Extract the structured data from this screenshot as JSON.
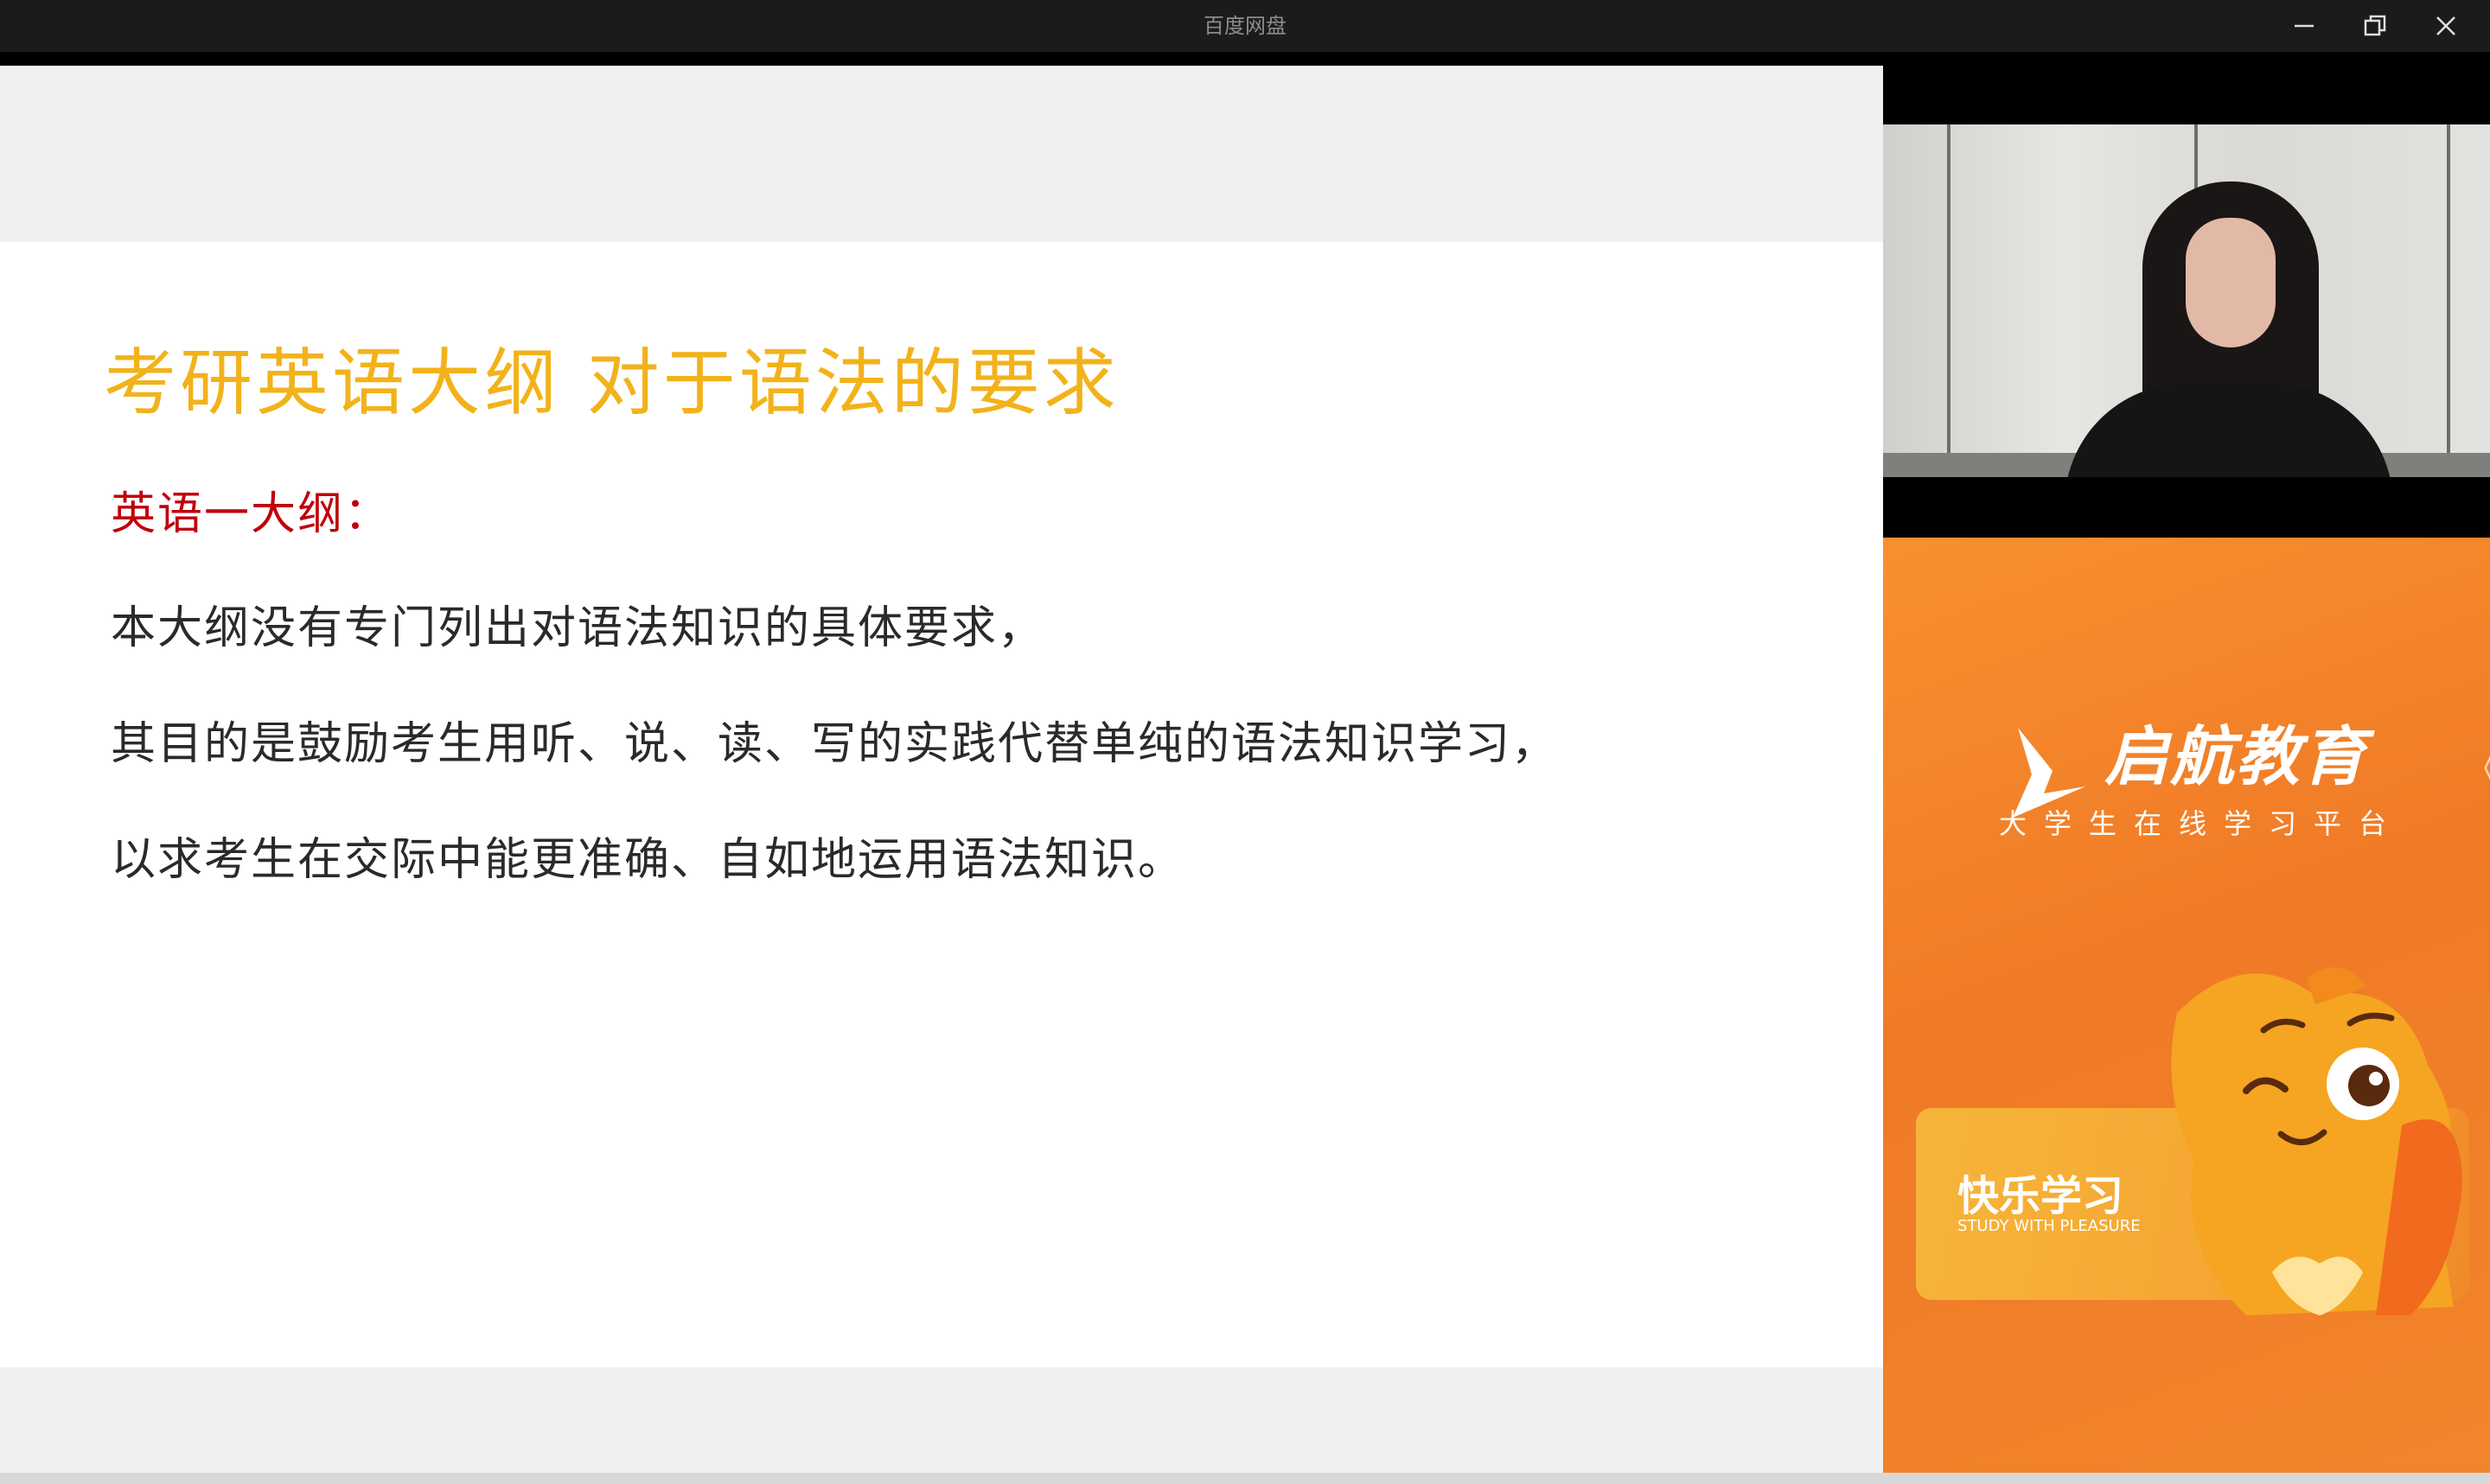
{
  "window": {
    "title": "百度网盘",
    "controls": {
      "minimize": "minimize-icon",
      "maximize": "restore-icon",
      "close": "close-icon"
    }
  },
  "slide": {
    "title": "考研英语大纲 对于语法的要求",
    "subtitle": "英语一大纲：",
    "lines": [
      "本大纲没有专门列出对语法知识的具体要求，",
      "其目的是鼓励考生用听、说、读、写的实践代替单纯的语法知识学习，",
      "以求考生在交际中能更准确、自如地运用语法知识。"
    ],
    "colors": {
      "title": "#f2b21a",
      "subtitle": "#c0000c",
      "body": "#2a2a2a"
    }
  },
  "sidebar": {
    "brand_name": "启航教育",
    "brand_sub": "大学生在线学习平台",
    "collapse_arrow": "《",
    "banner_title": "快乐学习",
    "banner_sub": "STUDY WITH PLEASURE",
    "colors": {
      "brand_bg": "#f07a26"
    }
  }
}
